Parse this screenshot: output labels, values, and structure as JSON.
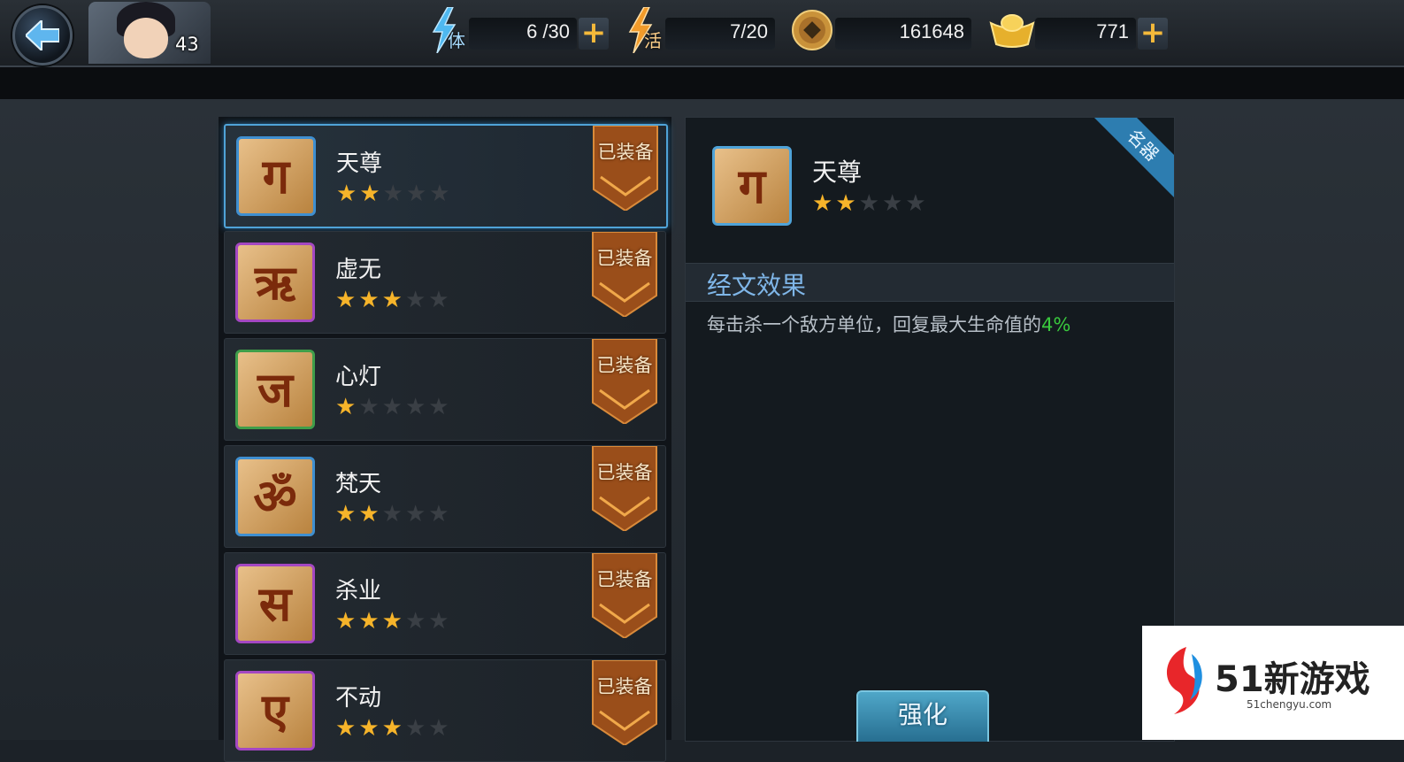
{
  "topbar": {
    "level": "43",
    "stamina": {
      "label": "体",
      "value": "6 /30"
    },
    "vitality": {
      "label": "活",
      "value": "7/20"
    },
    "coins": {
      "value": "161648"
    },
    "ingots": {
      "value": "771"
    },
    "plus_symbol": "+"
  },
  "scripture_list": {
    "items": [
      {
        "name": "天尊",
        "stars": 2,
        "glyph": "ग",
        "frame_color": "#3f8fd0",
        "badge": "已装备",
        "selected": true
      },
      {
        "name": "虚无",
        "stars": 3,
        "glyph": "ऋ",
        "frame_color": "#a447c2",
        "badge": "已装备",
        "selected": false
      },
      {
        "name": "心灯",
        "stars": 1,
        "glyph": "ज",
        "frame_color": "#3f9e4a",
        "badge": "已装备",
        "selected": false
      },
      {
        "name": "梵天",
        "stars": 2,
        "glyph": "ॐ",
        "frame_color": "#3f8fd0",
        "badge": "已装备",
        "selected": false
      },
      {
        "name": "杀业",
        "stars": 3,
        "glyph": "स",
        "frame_color": "#a447c2",
        "badge": "已装备",
        "selected": false
      },
      {
        "name": "不动",
        "stars": 3,
        "glyph": "ए",
        "frame_color": "#a447c2",
        "badge": "已装备",
        "selected": false
      }
    ]
  },
  "detail": {
    "ribbon": "名器",
    "name": "天尊",
    "stars": 2,
    "glyph": "ग",
    "effect_title": "经文效果",
    "effect_text": "每击杀一个敌方单位，回复最大生命值的",
    "effect_pct": "4%",
    "enhance_label": "强化"
  },
  "watermark": {
    "brand": "51新游戏",
    "domain": "51chengyu.com"
  },
  "colors": {
    "accent_blue": "#4fa3d8",
    "star_on": "#f6b42a",
    "effect_green": "#39c83d"
  }
}
